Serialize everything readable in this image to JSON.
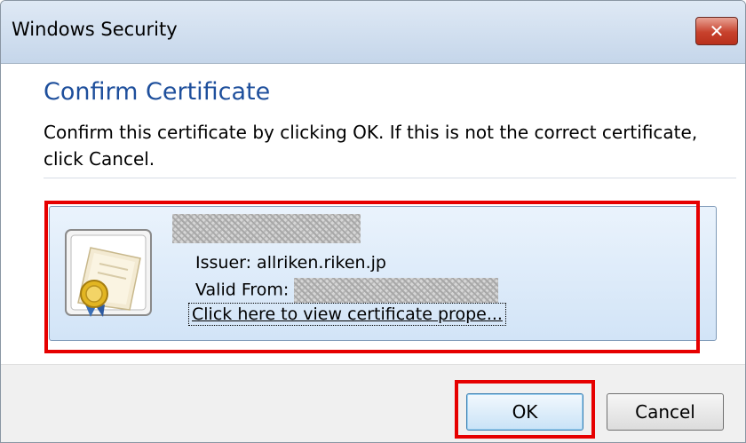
{
  "window": {
    "title": "Windows Security",
    "close_glyph": "✕"
  },
  "dialog": {
    "heading": "Confirm Certificate",
    "message": "Confirm this certificate by clicking OK. If this is not the correct certificate, click Cancel."
  },
  "certificate": {
    "icon": "certificate-icon",
    "issuer_label": "Issuer: allriken.riken.jp",
    "valid_from_label": "Valid From:",
    "view_link": "Click here to view certificate prope..."
  },
  "buttons": {
    "ok": "OK",
    "cancel": "Cancel"
  },
  "colors": {
    "highlight": "#e60000",
    "heading": "#1e4f9c"
  }
}
